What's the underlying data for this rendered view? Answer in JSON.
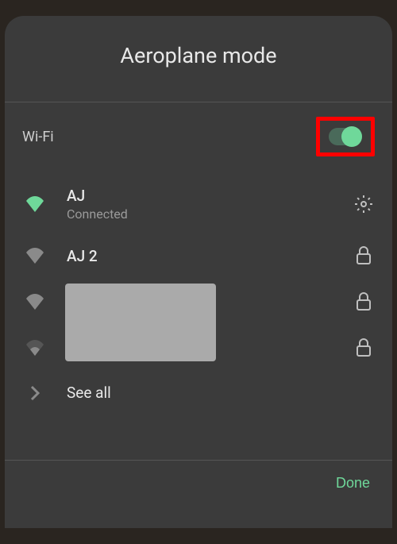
{
  "header": {
    "title": "Aeroplane mode"
  },
  "wifi": {
    "label": "Wi-Fi",
    "enabled": true
  },
  "networks": [
    {
      "name": "AJ",
      "status": "Connected",
      "connected": true,
      "secured": false
    },
    {
      "name": "AJ 2",
      "status": "",
      "connected": false,
      "secured": true
    }
  ],
  "see_all": {
    "label": "See all"
  },
  "footer": {
    "done": "Done"
  }
}
